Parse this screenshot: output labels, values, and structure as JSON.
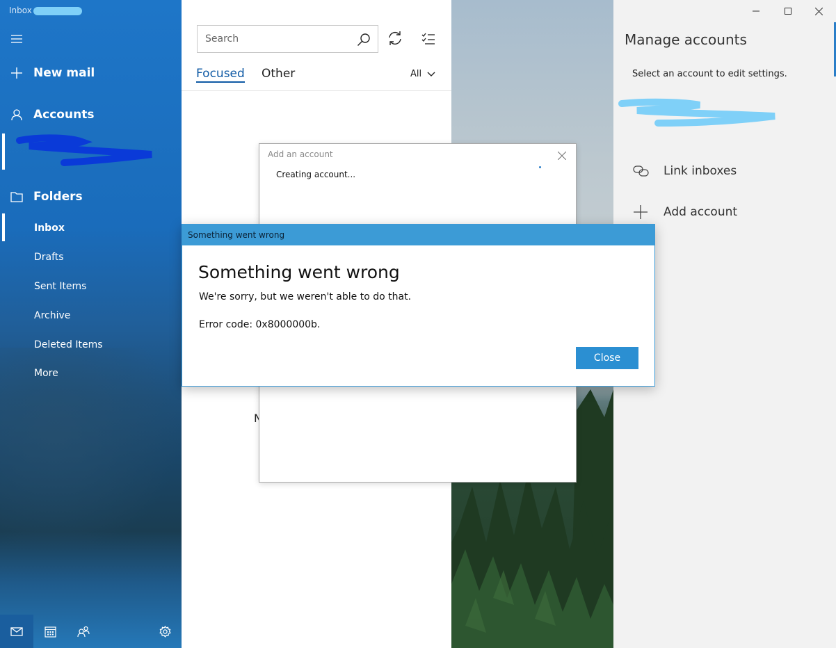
{
  "window": {
    "title": "Inbox"
  },
  "sidebar": {
    "new_mail": "New mail",
    "accounts": "Accounts",
    "folders_heading": "Folders",
    "folders": [
      {
        "label": "Inbox",
        "selected": true
      },
      {
        "label": "Drafts"
      },
      {
        "label": "Sent Items"
      },
      {
        "label": "Archive"
      },
      {
        "label": "Deleted Items"
      },
      {
        "label": "More"
      }
    ],
    "bottom_icons": [
      "mail-icon",
      "calendar-icon",
      "people-icon",
      "settings-icon"
    ]
  },
  "maillist": {
    "search_placeholder": "Search",
    "tabs": [
      {
        "label": "Focused",
        "active": true
      },
      {
        "label": "Other"
      }
    ],
    "filter": "All",
    "partial_text": "N"
  },
  "manage_accounts": {
    "title": "Manage accounts",
    "subtitle": "Select an account to edit settings.",
    "link_inboxes": "Link inboxes",
    "add_account": "Add account"
  },
  "add_account_dialog": {
    "title": "Add an account",
    "status": "Creating account..."
  },
  "error_dialog": {
    "bar_title": "Something went wrong",
    "heading": "Something went wrong",
    "message": "We're sorry, but we weren't able to do that.",
    "error_code": "Error code: 0x8000000b.",
    "close_label": "Close"
  },
  "colors": {
    "accent": "#0f5aa5",
    "dialog_bar": "#3c9bd6",
    "button": "#2b8fd2"
  }
}
